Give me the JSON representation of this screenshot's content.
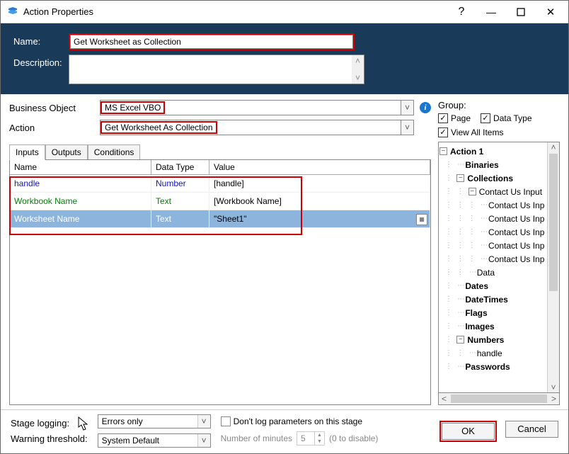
{
  "window": {
    "title": "Action Properties"
  },
  "header": {
    "name_label": "Name:",
    "name_value": "Get Worksheet as Collection",
    "desc_label": "Description:",
    "desc_value": ""
  },
  "form": {
    "bo_label": "Business Object",
    "bo_value": "MS Excel VBO",
    "action_label": "Action",
    "action_value": "Get Worksheet As Collection"
  },
  "tabs": {
    "inputs": "Inputs",
    "outputs": "Outputs",
    "conditions": "Conditions"
  },
  "grid": {
    "headers": {
      "name": "Name",
      "type": "Data Type",
      "value": "Value"
    },
    "rows": [
      {
        "name": "handle",
        "type": "Number",
        "value": "[handle]",
        "nameColor": "#1414b8",
        "typeColor": "#1414b8"
      },
      {
        "name": "Workbook Name",
        "type": "Text",
        "value": "[Workbook Name]",
        "nameColor": "#0a7a0a",
        "typeColor": "#0a7a0a"
      },
      {
        "name": "Worksheet Name",
        "type": "Text",
        "value": "\"Sheet1\"",
        "nameColor": "#fff",
        "typeColor": "#fff",
        "selected": true
      }
    ]
  },
  "group": {
    "label": "Group:",
    "page": "Page",
    "datatype": "Data Type",
    "viewall": "View All Items",
    "tree": {
      "root": "Action 1",
      "nodes": [
        {
          "level": 1,
          "label": "Binaries",
          "bold": true,
          "exp": ""
        },
        {
          "level": 1,
          "label": "Collections",
          "bold": true,
          "exp": "-"
        },
        {
          "level": 2,
          "label": "Contact Us Input",
          "bold": false,
          "exp": "-"
        },
        {
          "level": 3,
          "label": "Contact Us Inp",
          "bold": false,
          "exp": ""
        },
        {
          "level": 3,
          "label": "Contact Us Inp",
          "bold": false,
          "exp": ""
        },
        {
          "level": 3,
          "label": "Contact Us Inp",
          "bold": false,
          "exp": ""
        },
        {
          "level": 3,
          "label": "Contact Us Inp",
          "bold": false,
          "exp": ""
        },
        {
          "level": 3,
          "label": "Contact Us Inp",
          "bold": false,
          "exp": ""
        },
        {
          "level": 2,
          "label": "Data",
          "bold": false,
          "exp": ""
        },
        {
          "level": 1,
          "label": "Dates",
          "bold": true,
          "exp": ""
        },
        {
          "level": 1,
          "label": "DateTimes",
          "bold": true,
          "exp": ""
        },
        {
          "level": 1,
          "label": "Flags",
          "bold": true,
          "exp": ""
        },
        {
          "level": 1,
          "label": "Images",
          "bold": true,
          "exp": ""
        },
        {
          "level": 1,
          "label": "Numbers",
          "bold": true,
          "exp": "-"
        },
        {
          "level": 2,
          "label": "handle",
          "bold": false,
          "exp": ""
        },
        {
          "level": 1,
          "label": "Passwords",
          "bold": true,
          "exp": ""
        }
      ]
    }
  },
  "footer": {
    "stage_logging": "Stage logging:",
    "warn_threshold": "Warning threshold:",
    "errors_only": "Errors only",
    "system_default": "System Default",
    "dont_log": "Don't log parameters on this stage",
    "num_minutes": "Number of minutes",
    "num_minutes_val": "5",
    "to_disable": "(0 to disable)",
    "ok": "OK",
    "cancel": "Cancel"
  }
}
